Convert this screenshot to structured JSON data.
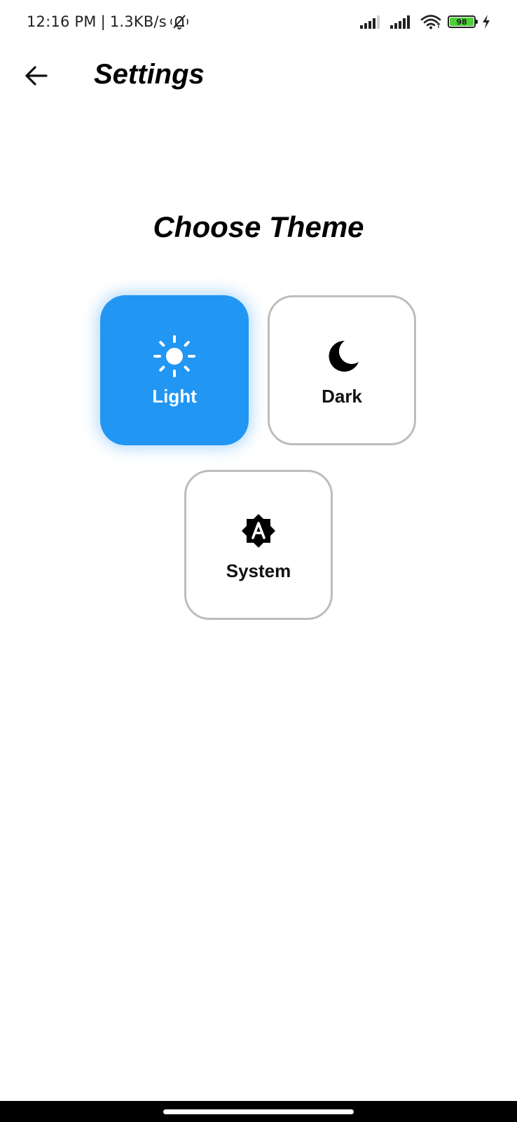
{
  "status_bar": {
    "time": "12:16 PM",
    "separator": "|",
    "net_speed": "1.3KB/s",
    "battery_level": "98",
    "battery_color": "#4cd137",
    "icons": [
      "mute-bell-icon",
      "signal-icon",
      "signal-icon",
      "wifi-icon",
      "battery-icon",
      "charging-icon"
    ]
  },
  "app_bar": {
    "back_icon": "arrow-left-icon",
    "title": "Settings"
  },
  "theme": {
    "heading": "Choose Theme",
    "selected": "Light",
    "accent_color": "#2196f3",
    "options": [
      {
        "label": "Light",
        "icon": "sun-icon",
        "selected": true
      },
      {
        "label": "Dark",
        "icon": "moon-icon",
        "selected": false
      },
      {
        "label": "System",
        "icon": "brightness-auto-icon",
        "selected": false
      }
    ]
  }
}
